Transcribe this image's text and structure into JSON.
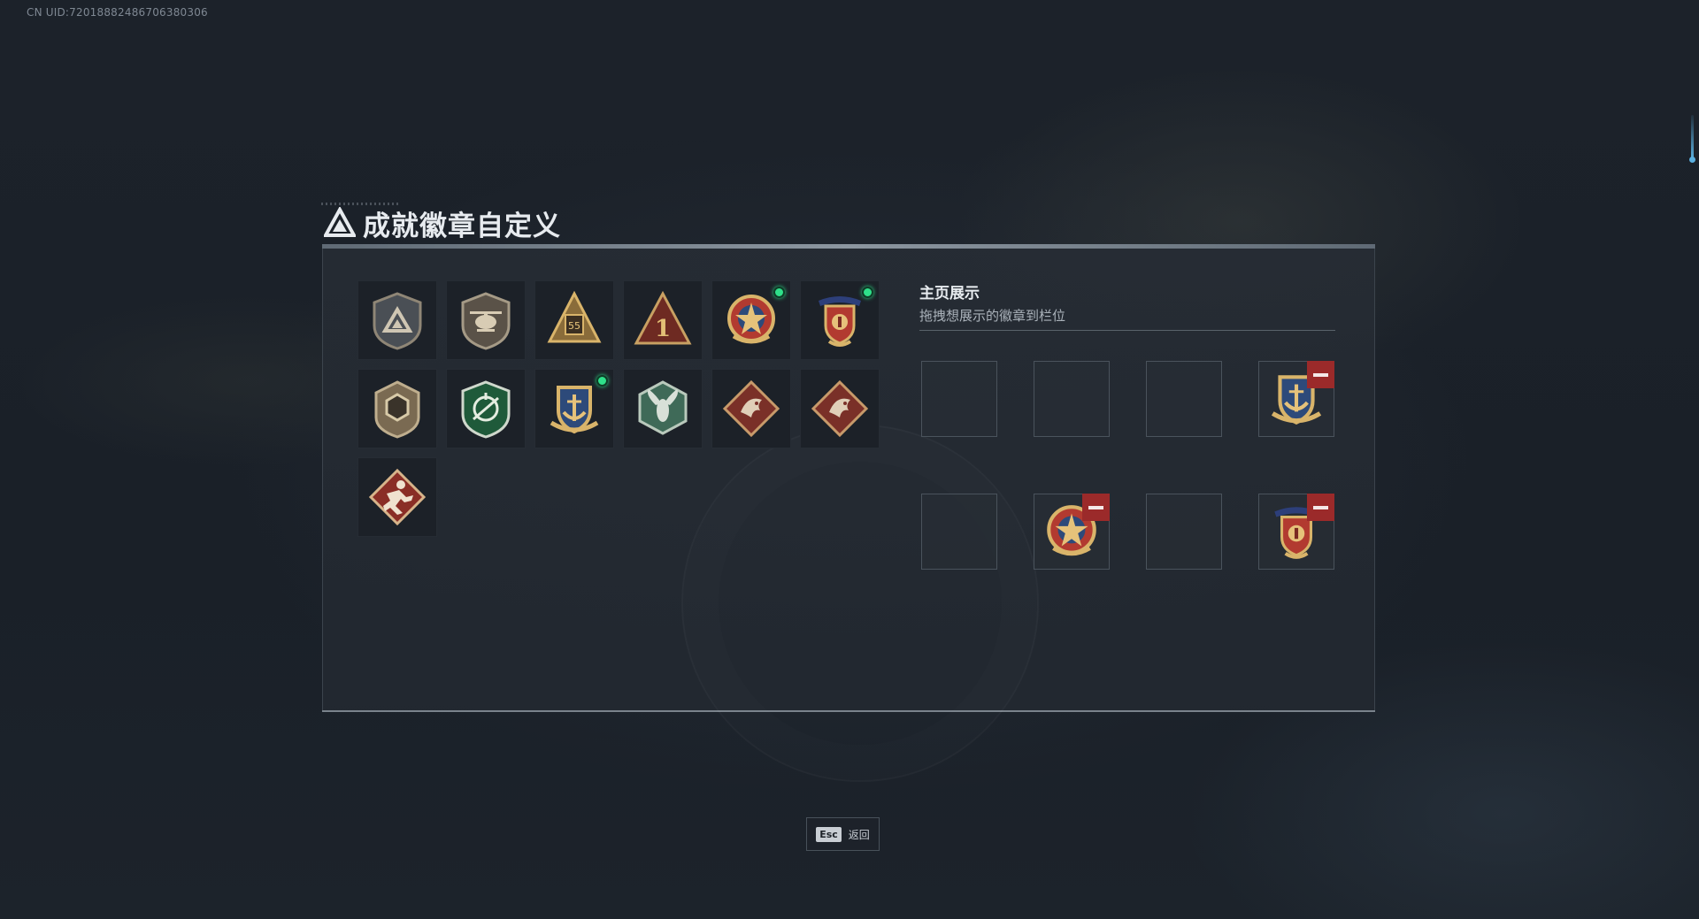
{
  "uid": "CN UID:72018882486706380306",
  "title": "成就徽章自定义",
  "showcase": {
    "title": "主页展示",
    "hint": "拖拽想展示的徽章到栏位"
  },
  "esc": {
    "key": "Esc",
    "label": "返回"
  },
  "badges": [
    {
      "icon": "triangle-shield-badge-icon",
      "new": false
    },
    {
      "icon": "helicopter-badge-icon",
      "new": false
    },
    {
      "icon": "gold-tower-55-badge-icon",
      "new": false
    },
    {
      "icon": "red-triangle-1-badge-icon",
      "new": false
    },
    {
      "icon": "star-medal-badge-icon",
      "new": true
    },
    {
      "icon": "crest-medal-badge-icon",
      "new": true
    },
    {
      "icon": "hexagon-gem-badge-icon",
      "new": false
    },
    {
      "icon": "green-crosshair-badge-icon",
      "new": false
    },
    {
      "icon": "anchor-crest-badge-icon",
      "new": true
    },
    {
      "icon": "wasp-badge-icon",
      "new": false
    },
    {
      "icon": "red-dragon-badge-icon",
      "new": false
    },
    {
      "icon": "red-dragon-badge-icon",
      "new": false
    },
    {
      "icon": "runner-badge-icon",
      "new": false
    }
  ],
  "slots": [
    {
      "badge": null
    },
    {
      "badge": null
    },
    {
      "badge": null
    },
    {
      "badge": "anchor-crest-badge-icon"
    },
    {
      "badge": null
    },
    {
      "badge": "star-medal-badge-icon"
    },
    {
      "badge": null
    },
    {
      "badge": "crest-medal-badge-icon"
    }
  ],
  "colors": {
    "new_dot": "#2fe08a",
    "remove": "#9b2a2a"
  }
}
